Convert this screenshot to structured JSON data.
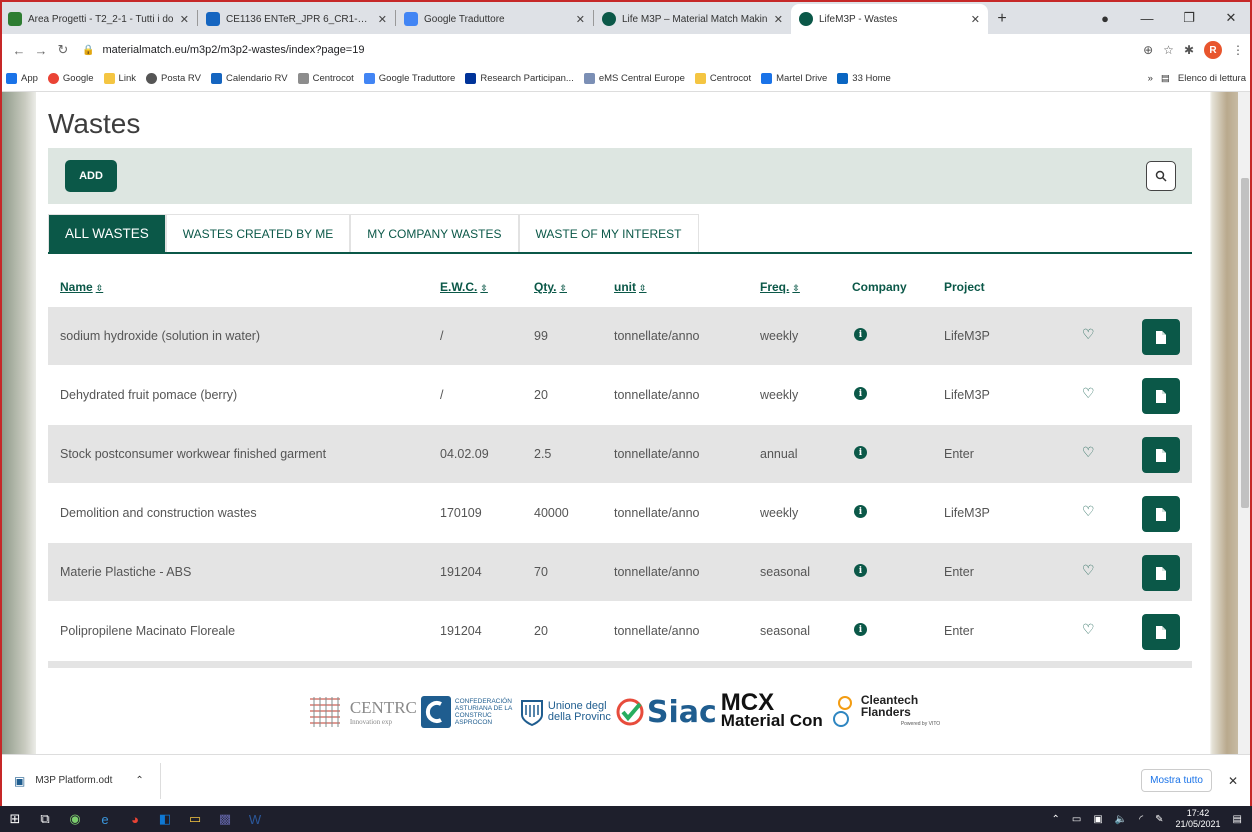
{
  "browser": {
    "tabs": [
      {
        "label": "Area Progetti - T2_2-1 - Tutti i do",
        "color": "#2e7d32"
      },
      {
        "label": "CE1136 ENTeR_JPR 6_CR1-Ver2.d",
        "color": "#1565c0"
      },
      {
        "label": "Google Traduttore",
        "color": "#4285f4"
      },
      {
        "label": "Life M3P – Material Match Makin",
        "color": "#0b5848"
      },
      {
        "label": "LifeM3P - Wastes",
        "color": "#0b5848"
      }
    ],
    "active_tab": 4,
    "url": "materialmatch.eu/m3p2/m3p2-wastes/index?page=19",
    "profile_initial": "R",
    "bookmarks": [
      "App",
      "Google",
      "Link",
      "Posta RV",
      "Calendario RV",
      "Centrocot",
      "Google Traduttore",
      "Research Participan...",
      "eMS Central Europe",
      "Centrocot",
      "Martel Drive",
      "33 Home"
    ],
    "bookmarks_more": "»",
    "reading_list": "Elenco di lettura"
  },
  "page": {
    "title": "Wastes",
    "add_label": "ADD",
    "tabs": [
      "ALL WASTES",
      "WASTES CREATED BY ME",
      "MY COMPANY WASTES",
      "WASTE OF MY INTEREST"
    ],
    "active_tab": 0,
    "columns": {
      "name": "Name",
      "ewc": "E.W.C.",
      "qty": "Qty.",
      "unit": "unit",
      "freq": "Freq.",
      "company": "Company",
      "project": "Project"
    },
    "rows": [
      {
        "name": "sodium hydroxide (solution in water)",
        "ewc": "/",
        "qty": "99",
        "unit": "tonnellate/anno",
        "freq": "weekly",
        "project": "LifeM3P"
      },
      {
        "name": "Dehydrated fruit pomace (berry)",
        "ewc": "/",
        "qty": "20",
        "unit": "tonnellate/anno",
        "freq": "weekly",
        "project": "LifeM3P"
      },
      {
        "name": "Stock postconsumer workwear finished garment",
        "ewc": "04.02.09",
        "qty": "2.5",
        "unit": "tonnellate/anno",
        "freq": "annual",
        "project": "Enter"
      },
      {
        "name": "Demolition and construction wastes",
        "ewc": "170109",
        "qty": "40000",
        "unit": "tonnellate/anno",
        "freq": "weekly",
        "project": "LifeM3P"
      },
      {
        "name": "Materie Plastiche - ABS",
        "ewc": "191204",
        "qty": "70",
        "unit": "tonnellate/anno",
        "freq": "seasonal",
        "project": "Enter"
      },
      {
        "name": "Polipropilene Macinato Floreale",
        "ewc": "191204",
        "qty": "20",
        "unit": "tonnellate/anno",
        "freq": "seasonal",
        "project": "Enter"
      }
    ],
    "logos": {
      "centro": "CENTRC",
      "centro_sub": "Innovation exp",
      "asturiana": "CONFEDERACIÓN ASTURIANA DE LA CONSTRUC",
      "asturiana_sub": "ASPROCON",
      "unione": "Unione degl",
      "unione_sub": "della Provinc",
      "siac": "Siac",
      "mcx": "MCX",
      "mcx_sub": "Material Con",
      "cleantech": "Cleantech",
      "cleantech_sub": "Flanders",
      "powered": "Powered by VITO"
    }
  },
  "downloads": {
    "file": "M3P Platform.odt",
    "show_all": "Mostra tutto"
  },
  "taskbar": {
    "time": "17:42",
    "date": "21/05/2021"
  },
  "colors": {
    "brand": "#0b5848",
    "toolbar_bg": "#dde6e1",
    "row_alt": "#e4e4e4"
  }
}
